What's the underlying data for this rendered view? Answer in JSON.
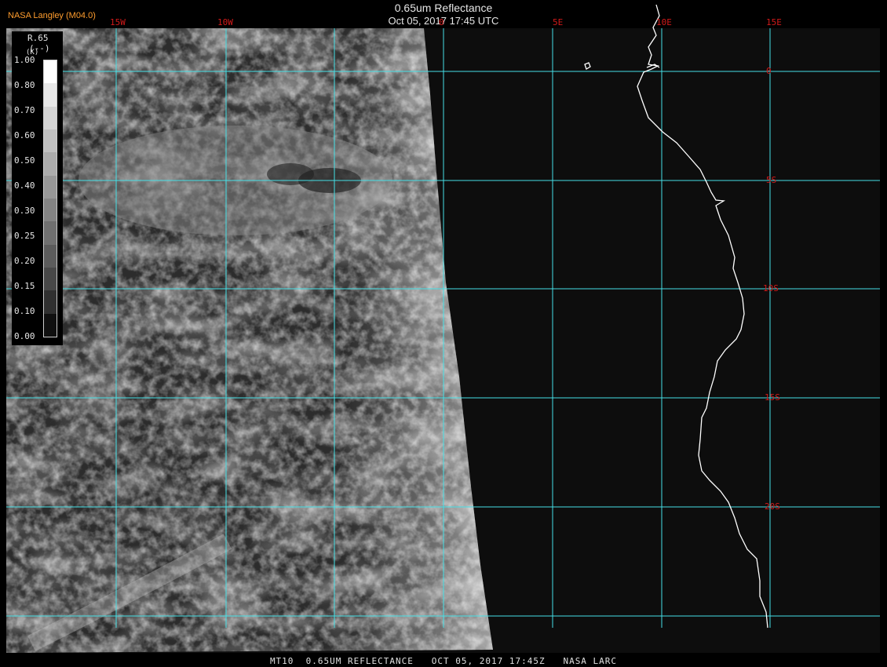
{
  "header": {
    "brand": "NASA Langley (M04.0)",
    "title": "0.65um Reflectance",
    "datetime": "Oct 05, 2017 17:45 UTC"
  },
  "footer": {
    "text": "MT10  0.65UM REFLECTANCE   OCT 05, 2017 17:45Z   NASA LARC"
  },
  "colorbar": {
    "title": "R.65",
    "unit": "(--)",
    "extra": "(K)",
    "ticks": [
      "1.00",
      "0.80",
      "0.70",
      "0.60",
      "0.50",
      "0.40",
      "0.30",
      "0.25",
      "0.20",
      "0.15",
      "0.10",
      "0.00"
    ],
    "colors": [
      "#ffffff",
      "#e8e8e8",
      "#d4d4d4",
      "#c0c0c0",
      "#acacac",
      "#989898",
      "#848484",
      "#707070",
      "#5c5c5c",
      "#484848",
      "#303030",
      "#101010"
    ]
  },
  "map": {
    "grid_color": "#45e0e6",
    "label_color": "#d21a1a",
    "coast_color": "#ffffff",
    "lon_labels": [
      "15W",
      "10W",
      "0",
      "5E",
      "10E",
      "15E"
    ],
    "lat_labels": [
      "0",
      "5S",
      "10S",
      "15S",
      "20S"
    ]
  }
}
